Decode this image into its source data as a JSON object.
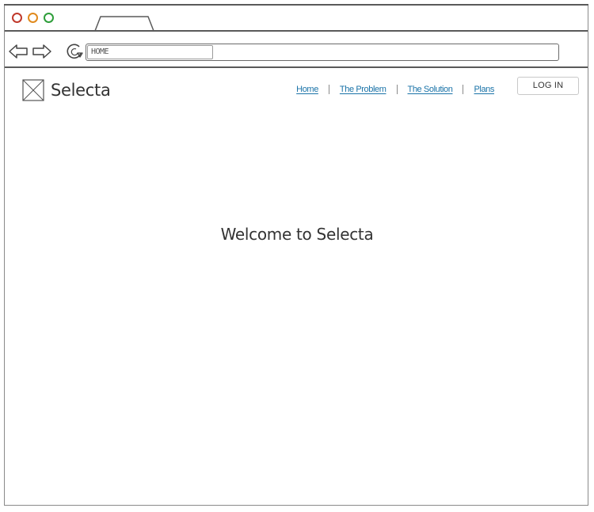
{
  "browser": {
    "address_value": "HOME",
    "traffic_lights": [
      "close",
      "minimize",
      "maximize"
    ],
    "colors": {
      "close": "#c0392b",
      "minimize": "#e08a1e",
      "maximize": "#2e9e3a"
    },
    "icons": {
      "back": "arrow-left-icon",
      "forward": "arrow-right-icon",
      "reload": "reload-icon"
    }
  },
  "header": {
    "brand": "Selecta",
    "logo_icon": "image-placeholder-icon",
    "nav": [
      {
        "label": "Home"
      },
      {
        "label": "The Problem"
      },
      {
        "label": "The Solution"
      },
      {
        "label": "Plans"
      }
    ],
    "login_label": "LOG IN",
    "link_color": "#1a73a8"
  },
  "main": {
    "heading": "Welcome to Selecta"
  }
}
